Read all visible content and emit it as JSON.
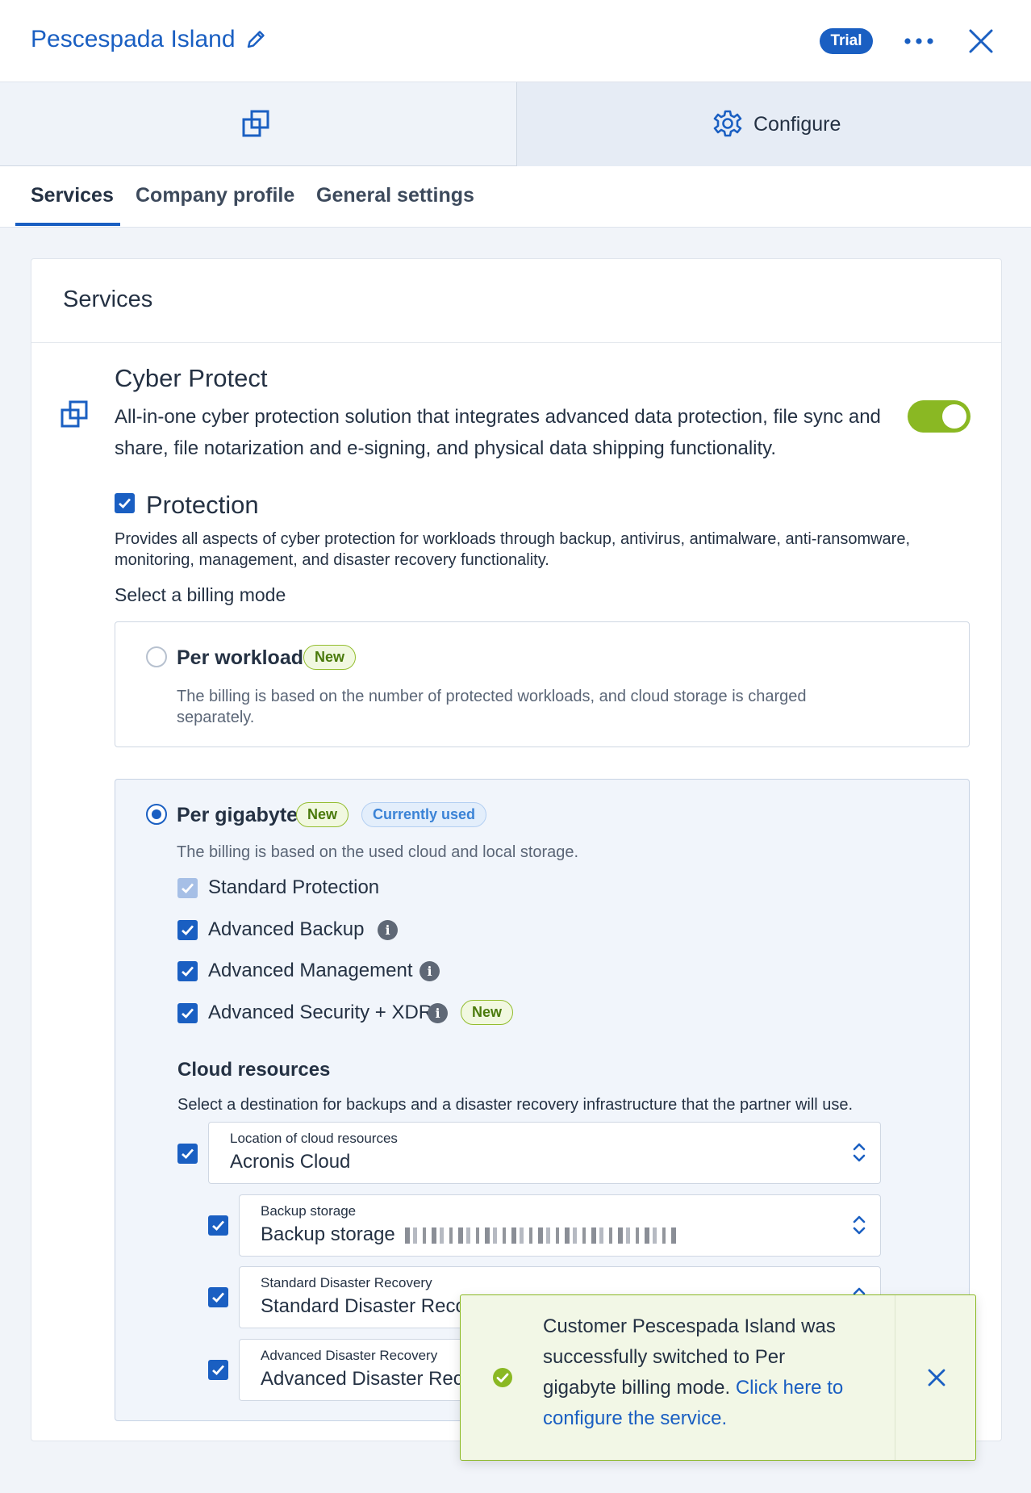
{
  "header": {
    "title": "Pescespada Island",
    "edit_icon": "pencil-icon",
    "badge": "Trial",
    "more_icon": "more-horizontal-icon",
    "close_icon": "close-icon"
  },
  "top_tabs": {
    "left_icon": "cyber-protect-icon",
    "configure_label": "Configure",
    "configure_icon": "gear-icon"
  },
  "subtabs": [
    {
      "label": "Services",
      "active": true
    },
    {
      "label": "Company profile",
      "active": false
    },
    {
      "label": "General settings",
      "active": false
    }
  ],
  "services": {
    "title": "Services",
    "cyber_protect": {
      "title": "Cyber Protect",
      "description": "All-in-one cyber protection solution that integrates advanced data protection, file sync and share, file notarization and e-signing, and physical data shipping functionality.",
      "enabled": true
    },
    "protection": {
      "label": "Protection",
      "checked": true,
      "description": "Provides all aspects of cyber protection for workloads through backup, antivirus, antimalware, anti-ransomware, monitoring, management, and disaster recovery functionality.",
      "billing_label": "Select a billing mode"
    },
    "per_workload": {
      "title": "Per workload",
      "badge": "New",
      "description": "The billing is based on the number of protected workloads, and cloud storage is charged separately.",
      "selected": false
    },
    "per_gigabyte": {
      "title": "Per gigabyte",
      "badge_new": "New",
      "badge_used": "Currently used",
      "description": "The billing is based on the used cloud and local storage.",
      "selected": true,
      "features": [
        {
          "label": "Standard Protection",
          "checked": true,
          "disabled": true
        },
        {
          "label": "Advanced Backup",
          "checked": true,
          "info": true
        },
        {
          "label": "Advanced Management",
          "checked": true,
          "info": true
        },
        {
          "label": "Advanced Security + XDR",
          "checked": true,
          "info": true,
          "badge": "New"
        }
      ]
    },
    "cloud_resources": {
      "title": "Cloud resources",
      "description": "Select a destination for backups and a disaster recovery infrastructure that the partner will use.",
      "location": {
        "label": "Location of cloud resources",
        "value": "Acronis Cloud"
      },
      "backup": {
        "label": "Backup storage",
        "value": "Backup storage"
      },
      "standard_dr": {
        "label": "Standard Disaster Recovery",
        "value": "Standard Disaster Reco"
      },
      "advanced_dr": {
        "label": "Advanced Disaster Recovery",
        "value": "Advanced Disaster Reco"
      }
    }
  },
  "toast": {
    "message": "Customer Pescespada Island was successfully switched to Per gigabyte billing mode. ",
    "link": "Click here to configure the service.",
    "icon": "success-check-icon",
    "close_icon": "close-icon"
  },
  "colors": {
    "brand": "#1a5fc2",
    "toggle_on": "#8ab823",
    "success": "#8ab823"
  }
}
